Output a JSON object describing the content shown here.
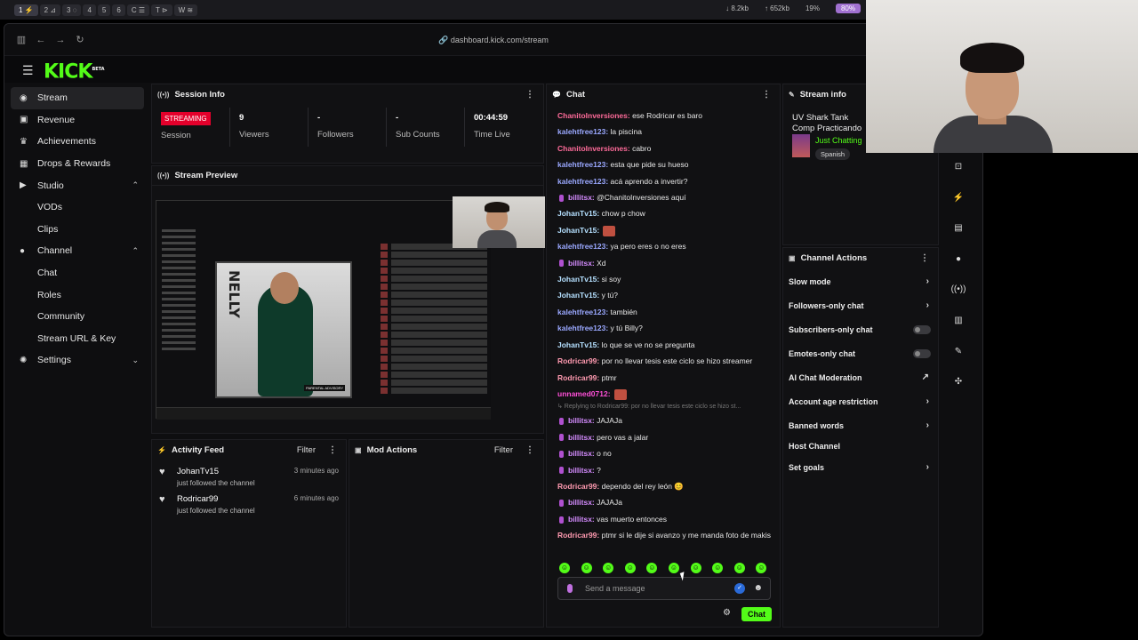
{
  "system": {
    "workspaces": [
      "1 ⚡",
      "2 ⊿",
      "3 ◌",
      "4",
      "5",
      "6",
      "C ☰",
      "T ⊳",
      "W ≋"
    ],
    "net_down": "↓  8.2kb",
    "net_up": "↑  652kb",
    "cpu": "19%",
    "battery": "80%"
  },
  "browser": {
    "url": "dashboard.kick.com/stream"
  },
  "brand": {
    "logo": "KICK",
    "beta": "BETA",
    "accent": "#53fc18"
  },
  "sidebar": {
    "items": [
      {
        "label": "Stream",
        "icon": "radio-icon"
      },
      {
        "label": "Revenue",
        "icon": "chart-icon"
      },
      {
        "label": "Achievements",
        "icon": "trophy-icon"
      },
      {
        "label": "Drops & Rewards",
        "icon": "gift-icon"
      },
      {
        "label": "Studio",
        "icon": "video-icon"
      },
      {
        "label": "VODs"
      },
      {
        "label": "Clips"
      },
      {
        "label": "Channel",
        "icon": "user-icon"
      },
      {
        "label": "Chat"
      },
      {
        "label": "Roles"
      },
      {
        "label": "Community"
      },
      {
        "label": "Stream URL & Key"
      },
      {
        "label": "Settings",
        "icon": "gear-icon"
      }
    ]
  },
  "session": {
    "title": "Session Info",
    "status": "STREAMING",
    "status_label": "Session",
    "viewers": "9",
    "viewers_label": "Viewers",
    "followers": "-",
    "followers_label": "Followers",
    "subs": "-",
    "subs_label": "Sub Counts",
    "time": "00:44:59",
    "time_label": "Time Live"
  },
  "preview": {
    "title": "Stream Preview"
  },
  "activity": {
    "title": "Activity Feed",
    "filter": "Filter",
    "items": [
      {
        "name": "JohanTv15",
        "desc": "just followed the channel",
        "time": "3 minutes ago"
      },
      {
        "name": "Rodricar99",
        "desc": "just followed the channel",
        "time": "6 minutes ago"
      }
    ]
  },
  "mod": {
    "title": "Mod Actions",
    "filter": "Filter"
  },
  "chat": {
    "title": "Chat",
    "messages": [
      {
        "user": "ChanitoInversiones:",
        "color": "#ff6b9a",
        "text": " ese Rodricar es baro"
      },
      {
        "user": "kalehtfree123:",
        "color": "#9aa8ff",
        "text": " la piscina"
      },
      {
        "user": "ChanitoInversiones:",
        "color": "#ff6b9a",
        "text": " cabro"
      },
      {
        "user": "kalehtfree123:",
        "color": "#9aa8ff",
        "text": " esta que pide su hueso"
      },
      {
        "user": "kalehtfree123:",
        "color": "#9aa8ff",
        "text": " acá aprendo a invertir?"
      },
      {
        "user": "billitsx:",
        "color": "#d58cff",
        "text": " @ChanitoInversiones aquí",
        "badge": true
      },
      {
        "user": "JohanTv15:",
        "color": "#b5e0ff",
        "text": " chow p chow"
      },
      {
        "user": "JohanTv15:",
        "color": "#b5e0ff",
        "text": "",
        "emote": true
      },
      {
        "user": "kalehtfree123:",
        "color": "#9aa8ff",
        "text": " ya pero eres o no eres"
      },
      {
        "user": "billitsx:",
        "color": "#d58cff",
        "text": " Xd",
        "badge": true
      },
      {
        "user": "JohanTv15:",
        "color": "#b5e0ff",
        "text": " si soy"
      },
      {
        "user": "JohanTv15:",
        "color": "#b5e0ff",
        "text": " y tú?"
      },
      {
        "user": "kalehtfree123:",
        "color": "#9aa8ff",
        "text": " también"
      },
      {
        "user": "kalehtfree123:",
        "color": "#9aa8ff",
        "text": " y tú Billy?"
      },
      {
        "user": "JohanTv15:",
        "color": "#b5e0ff",
        "text": " lo que se ve no se pregunta"
      },
      {
        "user": "Rodricar99:",
        "color": "#ff9ab0",
        "text": " por no llevar tesis este ciclo se hizo streamer"
      },
      {
        "user": "Rodricar99:",
        "color": "#ff9ab0",
        "text": " ptmr"
      },
      {
        "user": "unnamed0712:",
        "color": "#ff4fd8",
        "text": "",
        "emote": true
      }
    ],
    "reply_note": "↳ Replying to Rodricar99: por no llevar tesis este ciclo se hizo st...",
    "messages2": [
      {
        "user": "billitsx:",
        "color": "#d58cff",
        "text": " JAJAJa",
        "badge": true
      },
      {
        "user": "billitsx:",
        "color": "#d58cff",
        "text": " pero vas a jalar",
        "badge": true
      },
      {
        "user": "billitsx:",
        "color": "#d58cff",
        "text": " o no",
        "badge": true
      },
      {
        "user": "billitsx:",
        "color": "#d58cff",
        "text": " ?",
        "badge": true
      },
      {
        "user": "Rodricar99:",
        "color": "#ff9ab0",
        "text": " dependo del rey león 😊"
      },
      {
        "user": "billitsx:",
        "color": "#d58cff",
        "text": " JAJAJa",
        "badge": true
      },
      {
        "user": "billitsx:",
        "color": "#d58cff",
        "text": " vas muerto entonces",
        "badge": true
      }
    ],
    "last_message": {
      "user": "Rodricar99:",
      "color": "#ff9ab0",
      "text": " ptmr si le dije si avanzo y me manda foto de makis"
    },
    "placeholder": "Send a message",
    "send": "Chat"
  },
  "stream_info": {
    "title": "Stream info",
    "stream_title": "UV Shark Tank Comp Practicando",
    "category": "Just Chatting",
    "language": "Spanish"
  },
  "channel_actions": {
    "title": "Channel Actions",
    "items": [
      {
        "label": "Slow mode",
        "ctrl": "chevron"
      },
      {
        "label": "Followers-only chat",
        "ctrl": "chevron"
      },
      {
        "label": "Subscribers-only chat",
        "ctrl": "toggle"
      },
      {
        "label": "Emotes-only chat",
        "ctrl": "toggle"
      },
      {
        "label": "AI Chat Moderation",
        "ctrl": "external"
      },
      {
        "label": "Account age restriction",
        "ctrl": "chevron"
      },
      {
        "label": "Banned words",
        "ctrl": "chevron"
      },
      {
        "label": "Host Channel",
        "ctrl": "none"
      },
      {
        "label": "Set goals",
        "ctrl": "chevron"
      }
    ]
  }
}
